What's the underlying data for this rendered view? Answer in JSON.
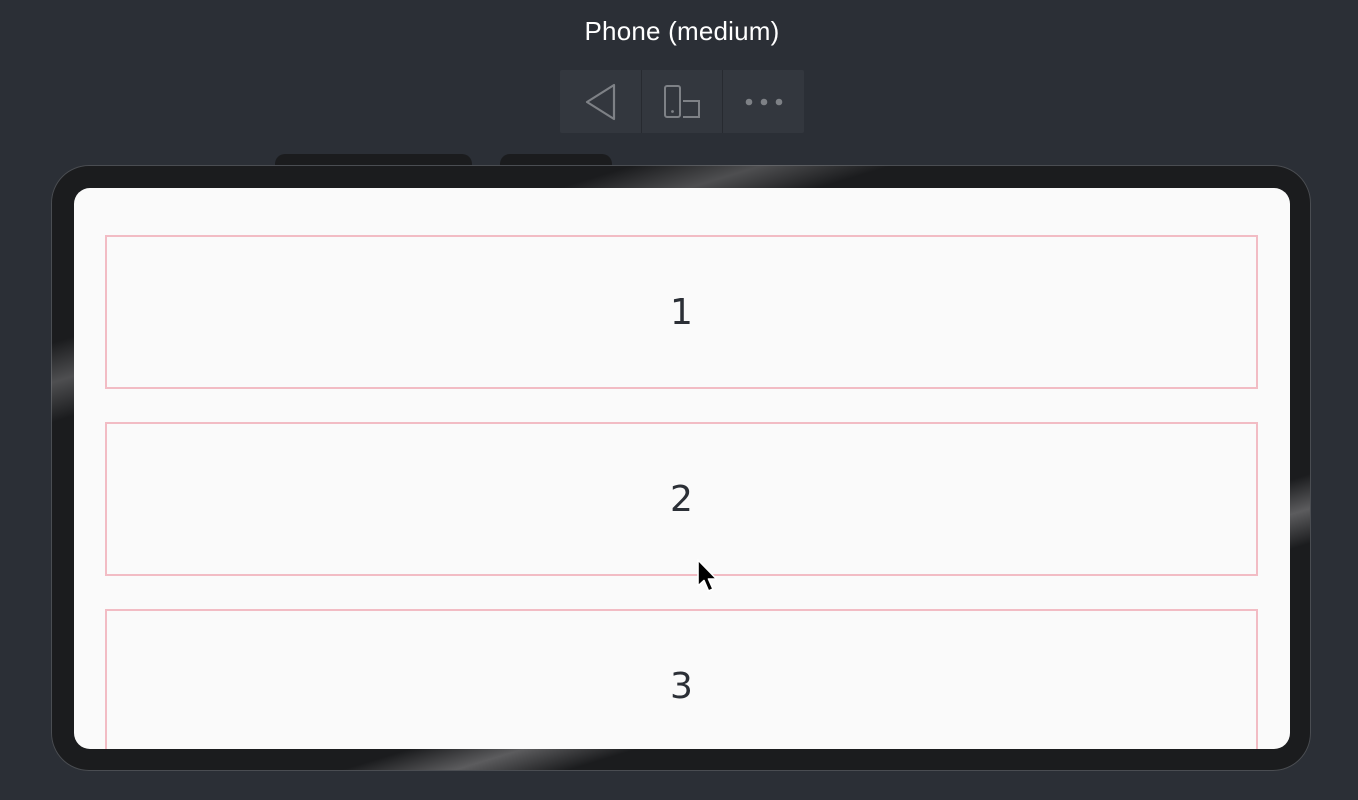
{
  "header": {
    "title": "Phone (medium)"
  },
  "toolbar": {
    "buttons": [
      {
        "name": "back",
        "icon": "back-triangle-icon"
      },
      {
        "name": "rotate",
        "icon": "rotate-device-icon"
      },
      {
        "name": "more",
        "icon": "more-dots-icon"
      }
    ]
  },
  "screen": {
    "items": [
      {
        "label": "1"
      },
      {
        "label": "2"
      },
      {
        "label": "3"
      }
    ]
  },
  "colors": {
    "background": "#2b2f36",
    "toolbar": "#33373e",
    "frame": "#1b1c1e",
    "screen": "#fafafa",
    "item_border": "#f2bcc4",
    "text": "#2b2f36"
  }
}
